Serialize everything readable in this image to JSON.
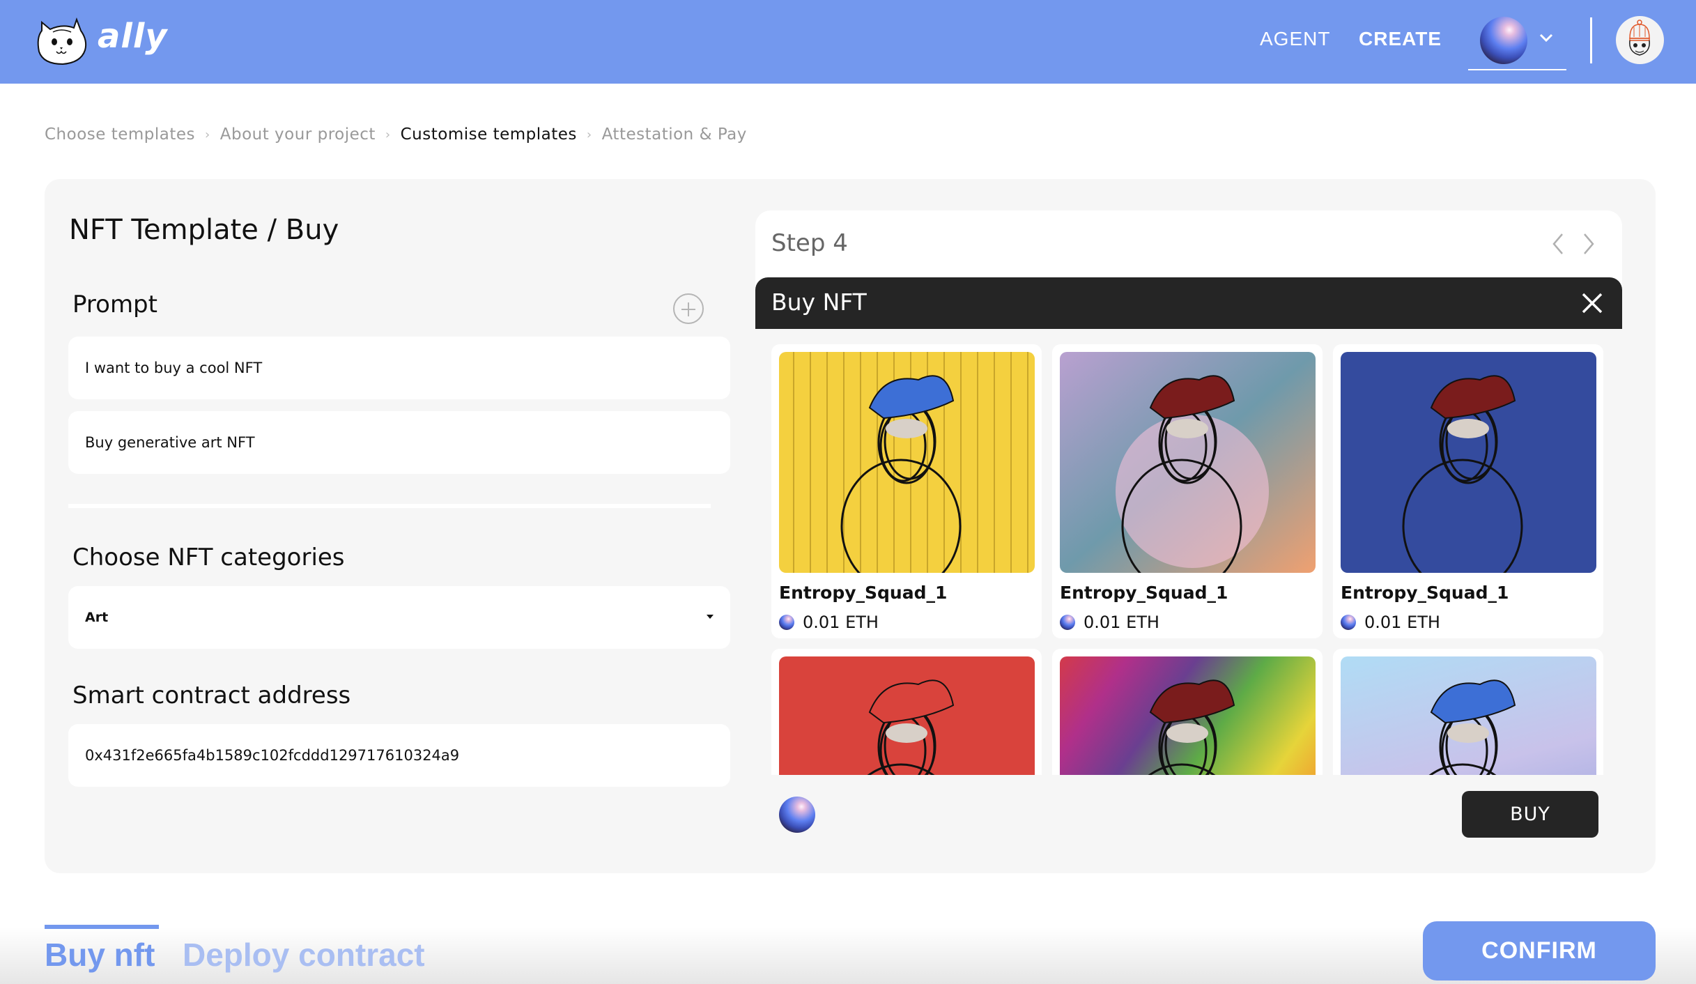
{
  "header": {
    "brand": "ally",
    "nav": [
      {
        "label": "AGENT",
        "active": false
      },
      {
        "label": "CREATE",
        "active": true
      }
    ],
    "network_icon": "eth-sphere-icon",
    "dropdown_icon": "chevron-down-icon",
    "avatar_icon": "user-avatar-icon"
  },
  "breadcrumb": [
    {
      "label": "Choose templates",
      "active": false
    },
    {
      "label": "About your project",
      "active": false
    },
    {
      "label": "Customise templates",
      "active": true
    },
    {
      "label": "Attestation & Pay",
      "active": false
    }
  ],
  "form": {
    "title": "NFT Template / Buy",
    "prompt_label": "Prompt",
    "prompts": [
      "I want to buy a cool NFT",
      "Buy generative art NFT"
    ],
    "categories_label": "Choose NFT categories",
    "category_selected": "Art",
    "contract_label": "Smart contract address",
    "contract_address": "0x431f2e665fa4b1589c102fcddd129717610324a9"
  },
  "step": {
    "label": "Step 4",
    "modal_title": "Buy NFT",
    "buy_label": "BUY"
  },
  "nfts": [
    {
      "name": "Entropy_Squad_1",
      "price": "0.01 ETH",
      "bg": "#f4d03f",
      "hat": "#3d6fd6",
      "theme": "yellow"
    },
    {
      "name": "Entropy_Squad_1",
      "price": "0.01 ETH",
      "bg": "#9fa8c8",
      "hat": "#7a1c1c",
      "theme": "pastel"
    },
    {
      "name": "Entropy_Squad_1",
      "price": "0.01 ETH",
      "bg": "#344b9e",
      "hat": "#7a1c1c",
      "theme": "blue"
    },
    {
      "name": "",
      "price": "",
      "bg": "#d9433c",
      "hat": "#d9433c",
      "theme": "red"
    },
    {
      "name": "",
      "price": "",
      "bg": "#8a5bb0",
      "hat": "#7a1c1c",
      "theme": "rainbow"
    },
    {
      "name": "",
      "price": "",
      "bg": "#b8d8f2",
      "hat": "#3d6fd6",
      "theme": "sky"
    }
  ],
  "bottom": {
    "tabs": [
      {
        "label": "Buy nft",
        "active": true
      },
      {
        "label": "Deploy contract",
        "active": false
      }
    ],
    "confirm_label": "CONFIRM"
  },
  "colors": {
    "brand": "#7398ee",
    "dark": "#252525",
    "panel_bg": "#f6f6f6"
  }
}
